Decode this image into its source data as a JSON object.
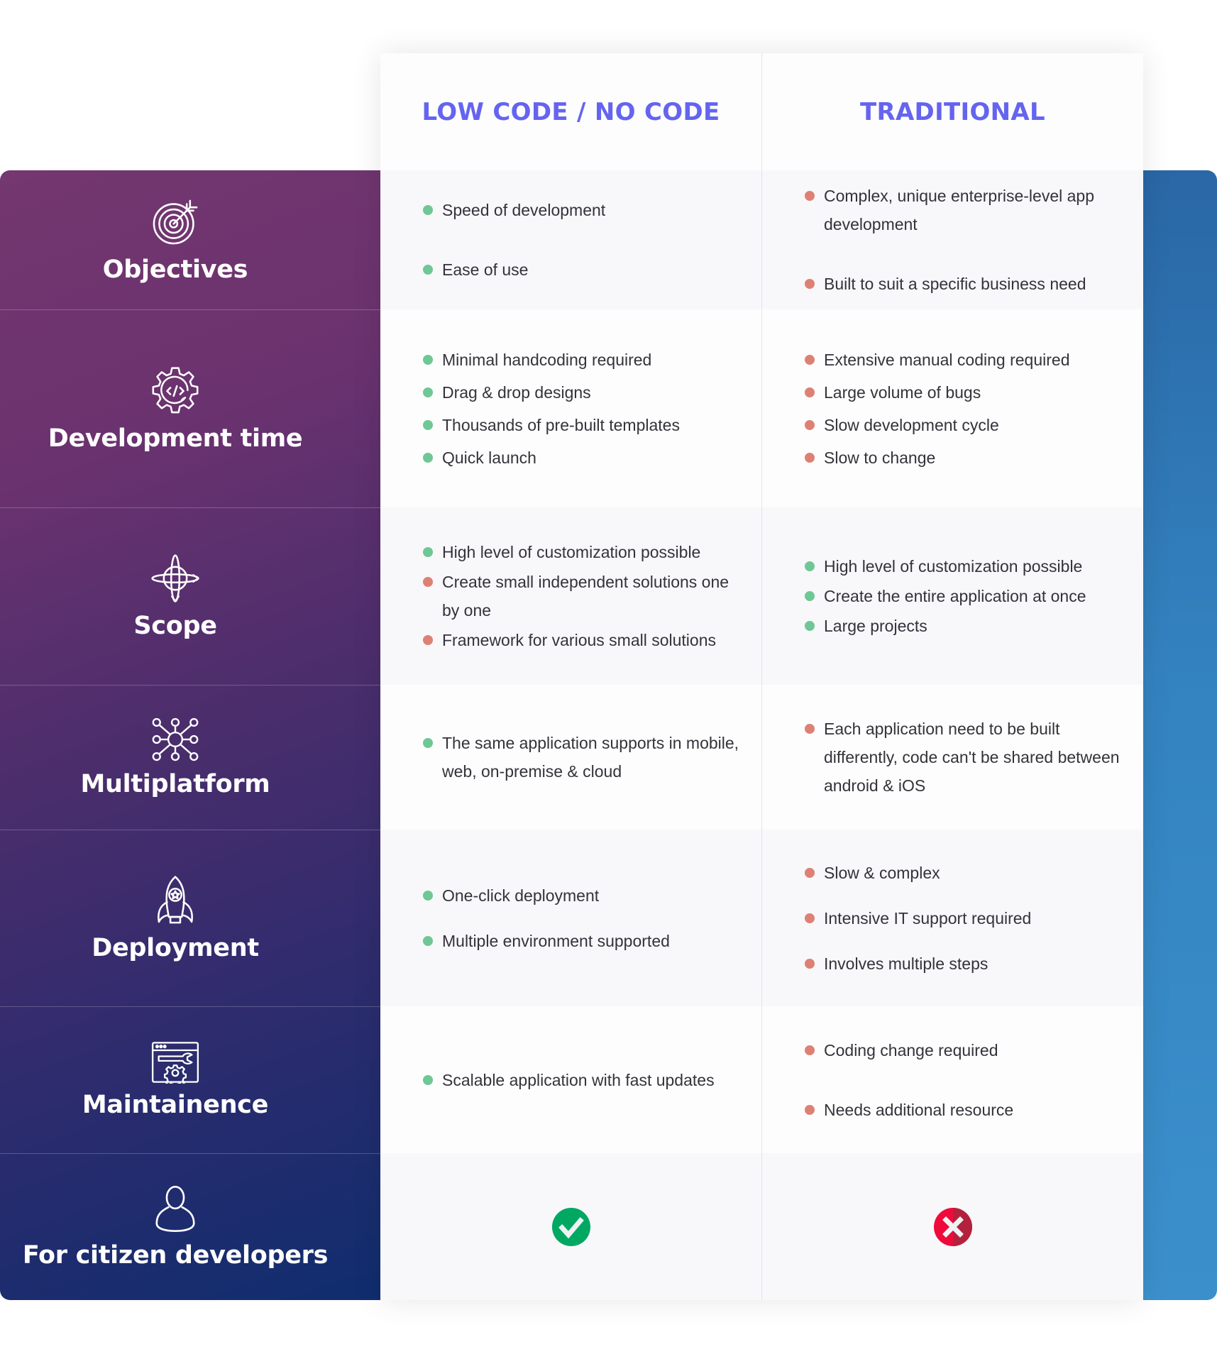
{
  "columns": {
    "low_code": "LOW CODE / NO CODE",
    "traditional": "TRADITIONAL"
  },
  "colors": {
    "header_text": "#6564f0",
    "pro_bullet": "#6fc795",
    "con_bullet": "#dd8174",
    "check_badge": "#00a862",
    "cross_badge": "#ef0a3c"
  },
  "rows": [
    {
      "label": "Objectives",
      "icon": "target-icon",
      "low_code": [
        {
          "text": "Speed of development",
          "type": "pro"
        },
        {
          "text": "Ease of use",
          "type": "pro"
        }
      ],
      "traditional": [
        {
          "text": "Complex, unique enterprise-level app development",
          "type": "con"
        },
        {
          "text": "Built to suit a specific business need",
          "type": "con"
        }
      ]
    },
    {
      "label": "Development time",
      "icon": "code-gear-icon",
      "low_code": [
        {
          "text": "Minimal handcoding required",
          "type": "pro"
        },
        {
          "text": "Drag & drop designs",
          "type": "pro"
        },
        {
          "text": "Thousands of pre-built templates",
          "type": "pro"
        },
        {
          "text": "Quick launch",
          "type": "pro"
        }
      ],
      "traditional": [
        {
          "text": "Extensive manual coding required",
          "type": "con"
        },
        {
          "text": "Large volume of bugs",
          "type": "con"
        },
        {
          "text": "Slow development cycle",
          "type": "con"
        },
        {
          "text": "Slow to change",
          "type": "con"
        }
      ]
    },
    {
      "label": "Scope",
      "icon": "orbit-globe-icon",
      "low_code": [
        {
          "text": "High level of customization possible",
          "type": "pro"
        },
        {
          "text": "Create small independent solutions one by one",
          "type": "con"
        },
        {
          "text": "Framework for various small solutions",
          "type": "con"
        }
      ],
      "traditional": [
        {
          "text": "High level of customization possible",
          "type": "pro"
        },
        {
          "text": "Create the entire application at once",
          "type": "pro"
        },
        {
          "text": "Large projects",
          "type": "pro"
        }
      ]
    },
    {
      "label": "Multiplatform",
      "icon": "network-hub-icon",
      "low_code": [
        {
          "text": "The same application supports in mobile, web, on-premise & cloud",
          "type": "pro"
        }
      ],
      "traditional": [
        {
          "text": "Each application need to be built differently, code can't be shared between android & iOS",
          "type": "con"
        }
      ]
    },
    {
      "label": "Deployment",
      "icon": "rocket-icon",
      "low_code": [
        {
          "text": "One-click deployment",
          "type": "pro"
        },
        {
          "text": "Multiple environment supported",
          "type": "pro"
        }
      ],
      "traditional": [
        {
          "text": "Slow & complex",
          "type": "con"
        },
        {
          "text": "Intensive IT support required",
          "type": "con"
        },
        {
          "text": "Involves multiple steps",
          "type": "con"
        }
      ]
    },
    {
      "label": "Maintainence",
      "icon": "browser-wrench-gear-icon",
      "low_code": [
        {
          "text": "Scalable application with fast updates",
          "type": "pro"
        }
      ],
      "traditional": [
        {
          "text": "Coding change required",
          "type": "con"
        },
        {
          "text": "Needs additional resource",
          "type": "con"
        }
      ]
    },
    {
      "label": "For citizen developers",
      "icon": "user-icon",
      "low_code_badge": "check-circle-icon",
      "traditional_badge": "cross-circle-icon"
    }
  ]
}
